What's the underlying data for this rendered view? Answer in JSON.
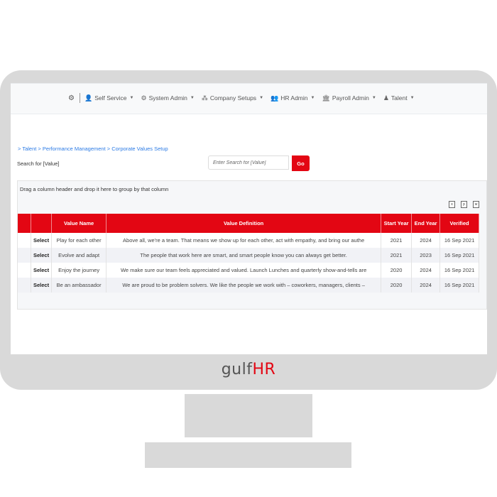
{
  "nav": {
    "settings_icon": "gear-icon",
    "items": [
      {
        "label": "Self Service",
        "icon": "user-list-icon"
      },
      {
        "label": "System Admin",
        "icon": "cog-icon"
      },
      {
        "label": "Company Setups",
        "icon": "sitemap-icon"
      },
      {
        "label": "HR Admin",
        "icon": "users-icon"
      },
      {
        "label": "Payroll Admin",
        "icon": "bank-icon"
      },
      {
        "label": "Talent",
        "icon": "user-tie-icon"
      }
    ]
  },
  "breadcrumb": "> Talent > Performance Management > Corporate Values Setup",
  "search": {
    "label": "Search for [Value]",
    "placeholder": "Enter Search for [Value]",
    "go_label": "Go"
  },
  "grid": {
    "group_hint": "Drag a column header and drop it here to group by that column",
    "export_icons": [
      "excel-export-icon",
      "pdf-export-icon",
      "word-export-icon"
    ],
    "columns": [
      "",
      "",
      "Value Name",
      "Value Definition",
      "Start Year",
      "End Year",
      "Verified"
    ],
    "rows": [
      {
        "select": "Select",
        "name": "Play for each other",
        "definition": "Above all, we're a team. That means we show up for each other, act with empathy, and bring our authe",
        "start": "2021",
        "end": "2024",
        "verified": "16 Sep 2021"
      },
      {
        "select": "Select",
        "name": "Evolve and adapt",
        "definition": "The people that work here are smart, and smart people know you can always get better.",
        "start": "2021",
        "end": "2023",
        "verified": "16 Sep 2021"
      },
      {
        "select": "Select",
        "name": "Enjoy the journey",
        "definition": "We make sure our team feels appreciated and valued. Launch Lunches and quarterly show-and-tells are",
        "start": "2020",
        "end": "2024",
        "verified": "16 Sep 2021"
      },
      {
        "select": "Select",
        "name": "Be an ambassador",
        "definition": "We are proud to be problem solvers. We like the people we work with – coworkers, managers, clients –",
        "start": "2020",
        "end": "2024",
        "verified": "16 Sep 2021"
      }
    ]
  },
  "brand": {
    "prefix": "gulf",
    "suffix": "HR"
  },
  "colors": {
    "accent": "#e30613",
    "link": "#2c7be5",
    "frame": "#d9d9d9"
  }
}
